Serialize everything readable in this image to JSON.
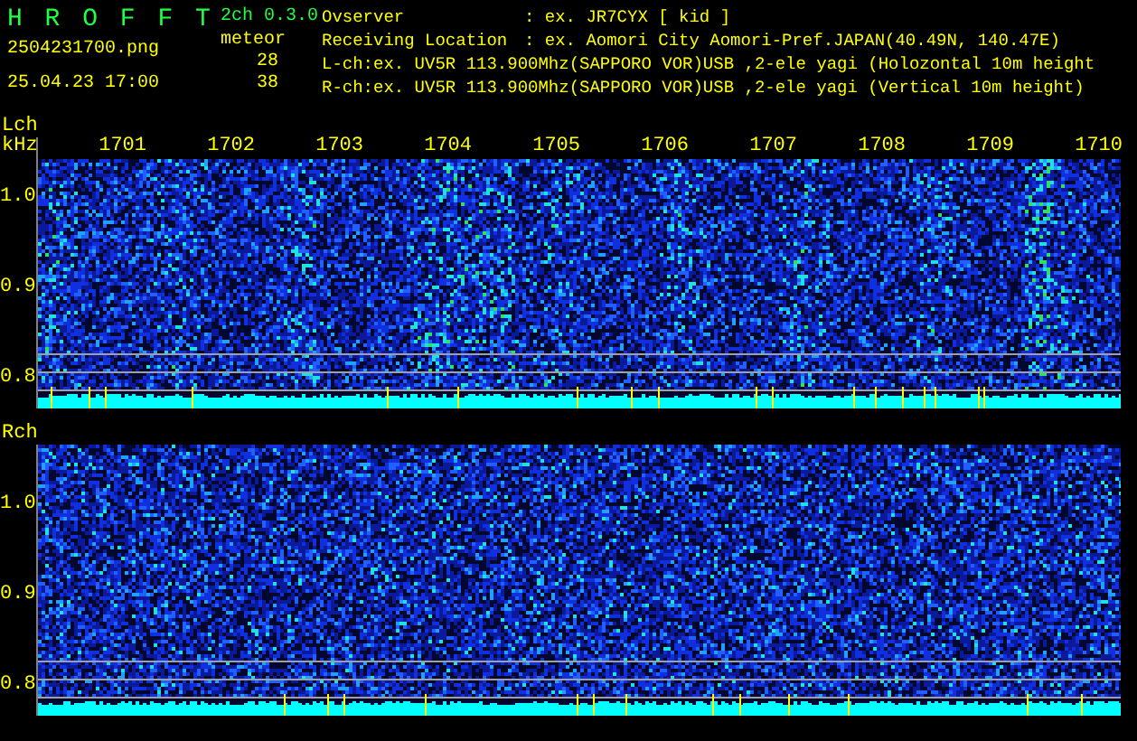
{
  "app": {
    "title": "H R O F F T",
    "version": "2ch 0.3.0",
    "mode": "meteor"
  },
  "file": {
    "name": "2504231700.png",
    "timestamp": "25.04.23 17:00"
  },
  "counts": [
    "28",
    "38"
  ],
  "info": [
    {
      "label": "Ovserver",
      "value": ": ex. JR7CYX [ kid ]"
    },
    {
      "label": "Receiving Location",
      "value": ": ex. Aomori City Aomori-Pref.JAPAN(40.49N, 140.47E)"
    }
  ],
  "channel_info": [
    "L-ch:ex. UV5R 113.900Mhz(SAPPORO VOR)USB ,2-ele yagi (Holozontal 10m height",
    "R-ch:ex. UV5R 113.900Mhz(SAPPORO VOR)USB ,2-ele yagi (Vertical 10m height)"
  ],
  "channels": [
    {
      "label": "Lch",
      "unit": "kHz",
      "time_labels": [
        "1701",
        "1702",
        "1703",
        "1704",
        "1705",
        "1706",
        "1707",
        "1708",
        "1709",
        "1710"
      ],
      "freq_labels": [
        "1.0",
        "0.9",
        "0.8"
      ]
    },
    {
      "label": "Rch",
      "freq_labels": [
        "1.0",
        "0.9",
        "0.8"
      ]
    }
  ]
}
